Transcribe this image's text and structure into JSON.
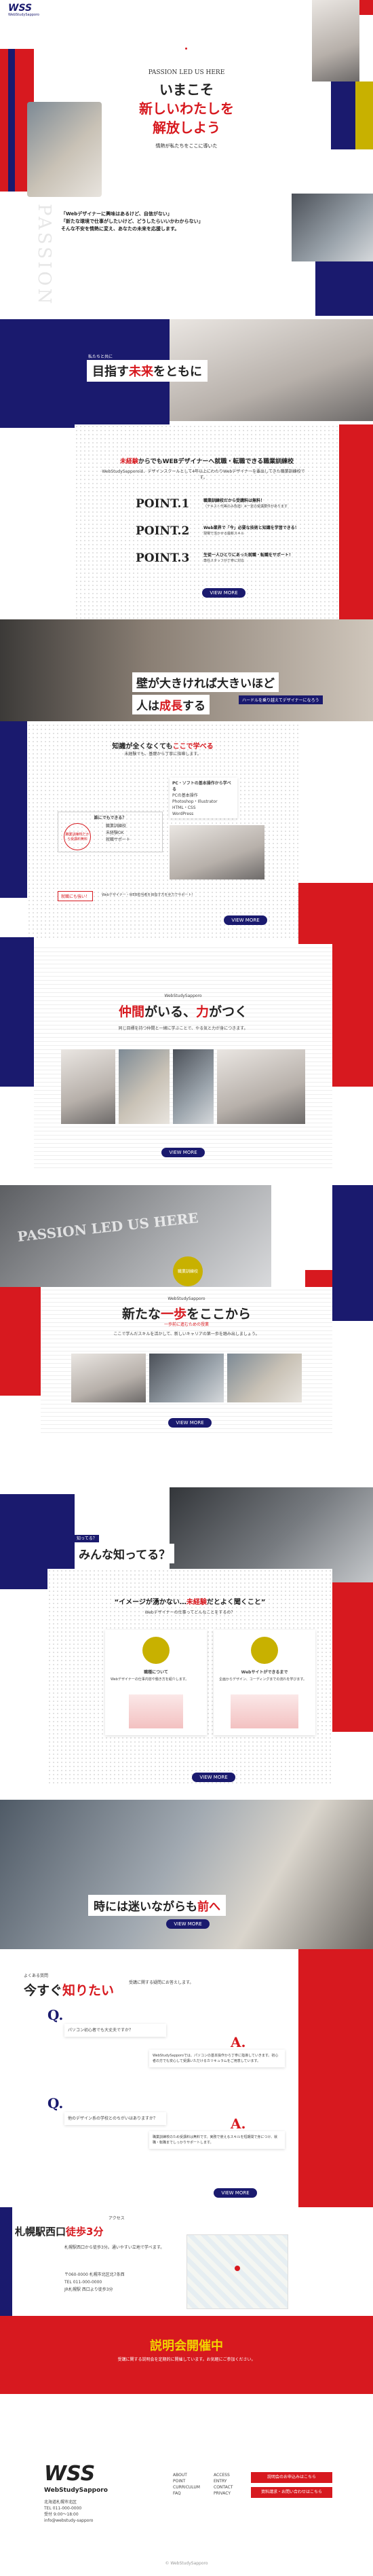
{
  "header": {
    "logo_text": "WSS",
    "logo_sub": "WebStudySapporo",
    "menu_icon": "hamburger-icon"
  },
  "hero": {
    "kicker": "PASSION LED US HERE",
    "lines": [
      "いまこそ",
      "新しいわたしを",
      "解放しよう"
    ],
    "sub": "情熱が私たちをここに導いた"
  },
  "intro": {
    "vertical": "PASSION",
    "lines": [
      "「Webデザイナーに興味はあるけど、自信がない」",
      "「新たな環境で仕事がしたいけど、どうしたらいいかわからない」",
      "そんな不安を情熱に変え、あなたの未来を応援します。"
    ]
  },
  "mirai": {
    "label": "私たちと共に",
    "title_a": "目指す",
    "title_b": "未来",
    "title_c": "をともに"
  },
  "points": {
    "lead_a": "未経験",
    "lead_b": "からでもWEBデザイナーへ就職・転職できる職業訓練校",
    "desc": "WebStudySapporoは、デザインスクールとして4年以上にわたりWebデザイナーを輩出してきた職業訓練校です。",
    "items": [
      {
        "no": "POINT.1",
        "text": "職業訓練校だから受講料は無料！",
        "sub": "（テキスト代等のみ負担）※一定の受講要件があります"
      },
      {
        "no": "POINT.2",
        "text": "Web業界で「今」必要な技術と知識を学習できる！",
        "sub": "現場で活かせる最新スキル"
      },
      {
        "no": "POINT.3",
        "text": "生徒一人ひとりにあった就職・転職をサポート！",
        "sub": "専任スタッフが丁寧に対応"
      }
    ],
    "button": "VIEW MORE"
  },
  "wall": {
    "line1": "壁が大きければ大きいほど",
    "line2_a": "人は",
    "line2_b": "成長",
    "line2_c": "する",
    "tag": "ハードルを乗り越えてデザイナーになろう"
  },
  "knowledge": {
    "title_a": "知識が全くなくても",
    "title_b": "ここで学べる",
    "desc": "未経験でも、基礎から丁寧に指導します。",
    "box_title": "PC・ソフトの基本操作から学べる",
    "box_items": [
      "PCの基本操作",
      "Photoshop・Illustrator",
      "HTML・CSS",
      "WordPress"
    ],
    "q": "誰にでもできる？",
    "q_items": [
      "職業訓練校",
      "未経験OK",
      "就職サポート"
    ],
    "circle": "職業訓練校だから受講料無料",
    "footnote": "Webデザイナー・WEB担当者を目指す方を全力でサポート！",
    "badge": "就職にも強い！",
    "button": "VIEW MORE"
  },
  "nakama": {
    "label": "WebStudySapporo",
    "title_a": "仲間",
    "title_b": "がいる、",
    "title_c": "力",
    "title_d": "がつく",
    "desc": "同じ目標を持つ仲間と一緒に学ぶことで、やる気と力が身につきます。",
    "button": "VIEW MORE"
  },
  "passion2": {
    "text": "PASSION LED US HERE",
    "badge": "職業訓練校"
  },
  "ippo": {
    "label": "WebStudySapporo",
    "title_a": "新たな",
    "title_b": "一歩",
    "title_c": "をここから",
    "sub": "一歩前に進むための授業",
    "desc": "ここで学んだスキルを活かして、新しいキャリアの第一歩を踏み出しましょう。",
    "button": "VIEW MORE"
  },
  "minna": {
    "label": "知ってる？",
    "title": "みんな知ってる？",
    "quote_a": "“イメージが湧かない…",
    "quote_b": "未経験",
    "quote_c": "だとよく聞くこと”",
    "desc": "Webデザイナーの仕事ってどんなことをするの？",
    "left": {
      "title": "職種について",
      "text": "Webデザイナーの仕事内容や働き方を紹介します。"
    },
    "right": {
      "title": "Webサイトができるまで",
      "text": "企画からデザイン、コーディングまでの流れを学びます。"
    },
    "button": "VIEW MORE"
  },
  "toki": {
    "a": "時には迷いながらも",
    "b": "前へ",
    "button": "VIEW MORE"
  },
  "faq": {
    "label": "よくある質問",
    "title_a": "今すぐ",
    "title_b": "知りたい",
    "desc": "受講に関する疑問にお答えします。",
    "q1": "パソコン初心者でも大丈夫ですか？",
    "a1": "WebStudySapporoでは、パソコンの基本操作から丁寧に指導していきます。初心者の方でも安心して受講いただけるカリキュラムをご用意しています。",
    "q2": "他のデザイン系の学校とのちがいはありますか？",
    "a2": "職業訓練校のため受講料は無料です。実務で使えるスキルを短期間で身につけ、就職・転職までしっかりサポートします。",
    "button": "VIEW MORE"
  },
  "access": {
    "label": "アクセス",
    "title_a": "札幌駅西口",
    "title_b": "徒歩3分",
    "desc": "札幌駅西口から徒歩3分。通いやすい立地で学べます。",
    "address": "〒060-0000 札幌市北区北7条西",
    "tel": "TEL 011-000-0000",
    "bus": "JR札幌駅 西口より徒歩3分"
  },
  "setsumei": {
    "title": "説明会開催中",
    "desc": "受講に関する説明会を定期的に開催しています。お気軽にご参加ください。"
  },
  "footer": {
    "logo": "WSS",
    "brand": "WebStudySapporo",
    "info": [
      "北海道札幌市北区",
      "TEL 011-000-0000",
      "受付 9:00〜18:00",
      "info@webstudy-sapporo"
    ],
    "nav1": [
      "ABOUT",
      "POINT",
      "CURRICULUM",
      "FAQ"
    ],
    "nav2": [
      "ACCESS",
      "ENTRY",
      "CONTACT",
      "PRIVACY"
    ],
    "cta1": "説明会のお申込みはこちら",
    "cta2": "資料請求・お問い合わせはこちら",
    "copyright": "© WebStudySapporo"
  }
}
